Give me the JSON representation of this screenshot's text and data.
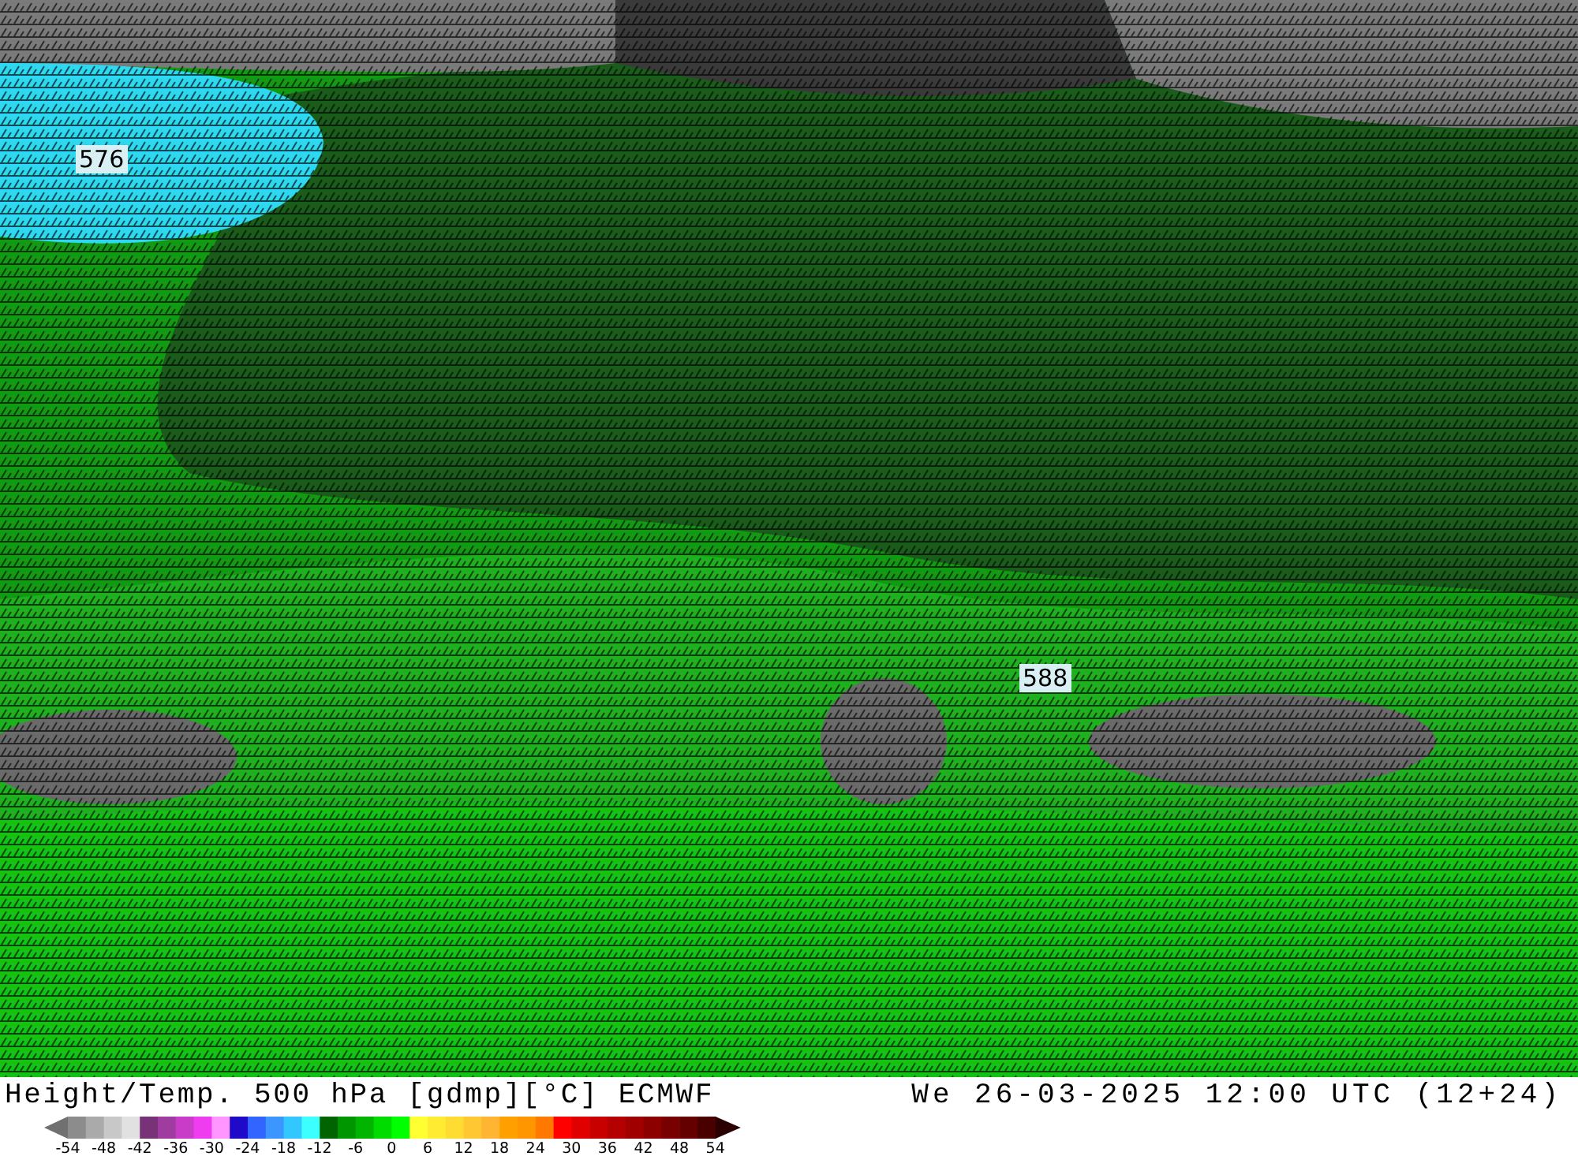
{
  "map": {
    "contour_labels": [
      "576",
      "588"
    ]
  },
  "footer": {
    "title": "Height/Temp. 500 hPa [gdmp][°C] ECMWF",
    "valid_time": "We 26-03-2025 12:00 UTC (12+24)"
  },
  "colorbar": {
    "swatches": [
      {
        "color": "#8c8c8c"
      },
      {
        "color": "#aaaaaa"
      },
      {
        "color": "#c8c8c8"
      },
      {
        "color": "#e1e1e1"
      },
      {
        "color": "#783278"
      },
      {
        "color": "#a03ca0"
      },
      {
        "color": "#c83cc8"
      },
      {
        "color": "#f03cf0"
      },
      {
        "color": "#ff96ff"
      },
      {
        "color": "#1e0ac8"
      },
      {
        "color": "#3264ff"
      },
      {
        "color": "#3c96ff"
      },
      {
        "color": "#32c8ff"
      },
      {
        "color": "#3cffff"
      },
      {
        "color": "#006400"
      },
      {
        "color": "#009600"
      },
      {
        "color": "#00b400"
      },
      {
        "color": "#00dc00"
      },
      {
        "color": "#00ff00"
      },
      {
        "color": "#ffff32"
      },
      {
        "color": "#ffeb32"
      },
      {
        "color": "#ffdc32"
      },
      {
        "color": "#ffc832"
      },
      {
        "color": "#ffb432"
      },
      {
        "color": "#ffa000"
      },
      {
        "color": "#ff9600"
      },
      {
        "color": "#ff7800"
      },
      {
        "color": "#ff0000"
      },
      {
        "color": "#e10000"
      },
      {
        "color": "#c80000"
      },
      {
        "color": "#b40000"
      },
      {
        "color": "#a00000"
      },
      {
        "color": "#8c0000"
      },
      {
        "color": "#780000"
      },
      {
        "color": "#640000"
      },
      {
        "color": "#4b0000"
      }
    ],
    "ticks": [
      "-54",
      "-48",
      "-42",
      "-36",
      "-30",
      "-24",
      "-18",
      "-12",
      "-6",
      "0",
      "6",
      "12",
      "18",
      "24",
      "30",
      "36",
      "42",
      "48",
      "54"
    ]
  }
}
